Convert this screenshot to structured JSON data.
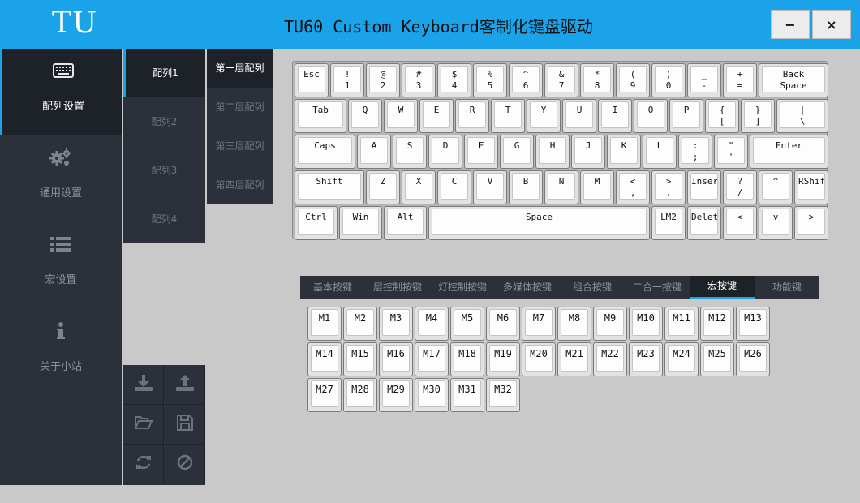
{
  "app": {
    "logo": "TU",
    "title": "TU60 Custom Keyboard客制化键盘驱动",
    "minimize_label": "−",
    "close_label": "×"
  },
  "sidebar": {
    "items": [
      {
        "label": "配列设置",
        "icon": "keyboard-icon",
        "active": true
      },
      {
        "label": "通用设置",
        "icon": "gears-icon",
        "active": false
      },
      {
        "label": "宏设置",
        "icon": "list-icon",
        "active": false
      },
      {
        "label": "关于小站",
        "icon": "info-icon",
        "active": false
      }
    ]
  },
  "layouts": {
    "items": [
      {
        "label": "配列1",
        "active": true
      },
      {
        "label": "配列2",
        "active": false
      },
      {
        "label": "配列3",
        "active": false
      },
      {
        "label": "配列4",
        "active": false
      }
    ]
  },
  "layers": {
    "items": [
      {
        "label": "第一层配列",
        "active": true
      },
      {
        "label": "第二层配列",
        "active": false
      },
      {
        "label": "第三层配列",
        "active": false
      },
      {
        "label": "第四层配列",
        "active": false
      }
    ]
  },
  "tools": {
    "items": [
      {
        "icon": "download-icon"
      },
      {
        "icon": "upload-icon"
      },
      {
        "icon": "folder-open-icon"
      },
      {
        "icon": "save-icon"
      },
      {
        "icon": "refresh-icon"
      },
      {
        "icon": "ban-icon"
      }
    ]
  },
  "keyboard": {
    "rows": [
      [
        {
          "label": "Esc",
          "u": 1
        },
        {
          "label": "!\n1",
          "u": 1
        },
        {
          "label": "@\n2",
          "u": 1
        },
        {
          "label": "#\n3",
          "u": 1
        },
        {
          "label": "$\n4",
          "u": 1
        },
        {
          "label": "%\n5",
          "u": 1
        },
        {
          "label": "^\n6",
          "u": 1
        },
        {
          "label": "&\n7",
          "u": 1
        },
        {
          "label": "*\n8",
          "u": 1
        },
        {
          "label": "(\n9",
          "u": 1
        },
        {
          "label": ")\n0",
          "u": 1
        },
        {
          "label": "_\n-",
          "u": 1
        },
        {
          "label": "+\n=",
          "u": 1
        },
        {
          "label": "Back\nSpace",
          "u": 2
        }
      ],
      [
        {
          "label": "Tab",
          "u": 1.5
        },
        {
          "label": "Q",
          "u": 1
        },
        {
          "label": "W",
          "u": 1
        },
        {
          "label": "E",
          "u": 1
        },
        {
          "label": "R",
          "u": 1
        },
        {
          "label": "T",
          "u": 1
        },
        {
          "label": "Y",
          "u": 1
        },
        {
          "label": "U",
          "u": 1
        },
        {
          "label": "I",
          "u": 1
        },
        {
          "label": "O",
          "u": 1
        },
        {
          "label": "P",
          "u": 1
        },
        {
          "label": "{\n[",
          "u": 1
        },
        {
          "label": "}\n]",
          "u": 1
        },
        {
          "label": "|\n\\",
          "u": 1.5
        }
      ],
      [
        {
          "label": "Caps",
          "u": 1.75
        },
        {
          "label": "A",
          "u": 1
        },
        {
          "label": "S",
          "u": 1
        },
        {
          "label": "D",
          "u": 1
        },
        {
          "label": "F",
          "u": 1
        },
        {
          "label": "G",
          "u": 1
        },
        {
          "label": "H",
          "u": 1
        },
        {
          "label": "J",
          "u": 1
        },
        {
          "label": "K",
          "u": 1
        },
        {
          "label": "L",
          "u": 1
        },
        {
          "label": ":\n;",
          "u": 1
        },
        {
          "label": "\"\n'",
          "u": 1
        },
        {
          "label": "Enter",
          "u": 2.25
        }
      ],
      [
        {
          "label": "Shift",
          "u": 2
        },
        {
          "label": "Z",
          "u": 1
        },
        {
          "label": "X",
          "u": 1
        },
        {
          "label": "C",
          "u": 1
        },
        {
          "label": "V",
          "u": 1
        },
        {
          "label": "B",
          "u": 1
        },
        {
          "label": "N",
          "u": 1
        },
        {
          "label": "M",
          "u": 1
        },
        {
          "label": "<\n,",
          "u": 1
        },
        {
          "label": ">\n.",
          "u": 1
        },
        {
          "label": "Insert",
          "u": 1
        },
        {
          "label": "?\n/",
          "u": 1
        },
        {
          "label": "^",
          "u": 1
        },
        {
          "label": "RShift",
          "u": 1
        }
      ],
      [
        {
          "label": "Ctrl",
          "u": 1.25
        },
        {
          "label": "Win",
          "u": 1.25
        },
        {
          "label": "Alt",
          "u": 1.25
        },
        {
          "label": "Space",
          "u": 6.25
        },
        {
          "label": "LM2",
          "u": 1
        },
        {
          "label": "Delete",
          "u": 1
        },
        {
          "label": "<",
          "u": 1
        },
        {
          "label": "v",
          "u": 1
        },
        {
          "label": ">",
          "u": 1
        }
      ]
    ]
  },
  "categories": {
    "items": [
      {
        "label": "基本按键",
        "active": false
      },
      {
        "label": "层控制按键",
        "active": false
      },
      {
        "label": "灯控制按键",
        "active": false
      },
      {
        "label": "多媒体按键",
        "active": false
      },
      {
        "label": "组合按键",
        "active": false
      },
      {
        "label": "二合一按键",
        "active": false
      },
      {
        "label": "宏按键",
        "active": true
      },
      {
        "label": "功能键",
        "active": false
      }
    ]
  },
  "macros": {
    "keys": [
      "M1",
      "M2",
      "M3",
      "M4",
      "M5",
      "M6",
      "M7",
      "M8",
      "M9",
      "M10",
      "M11",
      "M12",
      "M13",
      "M14",
      "M15",
      "M16",
      "M17",
      "M18",
      "M19",
      "M20",
      "M21",
      "M22",
      "M23",
      "M24",
      "M25",
      "M26",
      "M27",
      "M28",
      "M29",
      "M30",
      "M31",
      "M32"
    ]
  },
  "colors": {
    "accent": "#1aa3e8",
    "sidebar_bg": "#2b303a",
    "sidebar_active_bg": "#1d2128",
    "content_bg": "#c9c9c9"
  }
}
